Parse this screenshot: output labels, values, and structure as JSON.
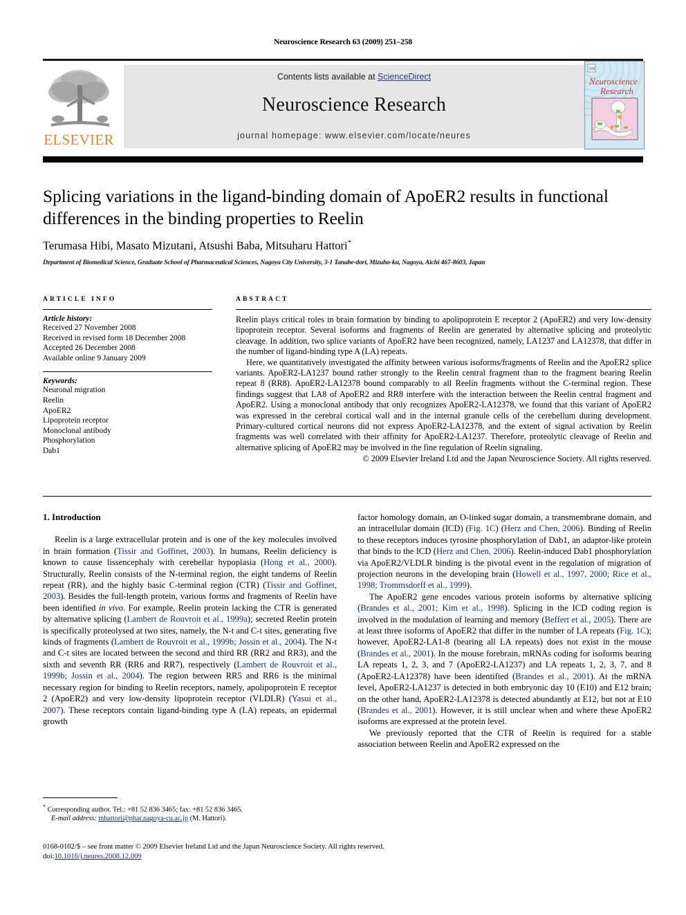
{
  "running_head": "Neuroscience Research 63 (2009) 251–258",
  "masthead": {
    "contents_prefix": "Contents lists available at ",
    "sciencedirect": "ScienceDirect",
    "journal_name": "Neuroscience Research",
    "homepage": "journal homepage: www.elsevier.com/locate/neures",
    "publisher_wordmark": "ELSEVIER",
    "cover_title_line1": "Neuroscience",
    "cover_title_line2": "Research",
    "accent_orange": "#F58220",
    "link_blue": "#2b3a8f",
    "reference_blue": "#1b2a73",
    "masthead_bg": "#e6e6e6"
  },
  "article": {
    "title": "Splicing variations in the ligand-binding domain of ApoER2 results in functional differences in the binding properties to Reelin",
    "authors": "Terumasa Hibi, Masato Mizutani, Atsushi Baba, Mitsuharu Hattori",
    "author_footnote_marker": "*",
    "affiliation": "Department of Biomedical Science, Graduate School of Pharmaceutical Sciences, Nagoya City University, 3-1 Tanabe-dori, Mizuho-ku, Nagoya, Aichi 467-8603, Japan"
  },
  "article_info": {
    "heading": "ARTICLE INFO",
    "history_label": "Article history:",
    "history": [
      "Received 27 November 2008",
      "Received in revised form 18 December 2008",
      "Accepted 26 December 2008",
      "Available online 9 January 2009"
    ],
    "keywords_label": "Keywords:",
    "keywords": [
      "Neuronal migration",
      "Reelin",
      "ApoER2",
      "Lipoprotein receptor",
      "Monoclonal antibody",
      "Phosphorylation",
      "Dab1"
    ]
  },
  "abstract": {
    "heading": "ABSTRACT",
    "paragraph1": "Reelin plays critical roles in brain formation by binding to apolipoprotein E receptor 2 (ApoER2) and very low-density lipoprotein receptor. Several isoforms and fragments of Reelin are generated by alternative splicing and proteolytic cleavage. In addition, two splice variants of ApoER2 have been recognized, namely, LA1237 and LA12378, that differ in the number of ligand-binding type A (LA) repeats.",
    "paragraph2": "Here, we quantitatively investigated the affinity between various isoforms/fragments of Reelin and the ApoER2 splice variants. ApoER2-LA1237 bound rather strongly to the Reelin central fragment than to the fragment bearing Reelin repeat 8 (RR8). ApoER2-LA12378 bound comparably to all Reelin fragments without the C-terminal region. These findings suggest that LA8 of ApoER2 and RR8 interfere with the interaction between the Reelin central fragment and ApoER2. Using a monoclonal antibody that only recognizes ApoER2-LA12378, we found that this variant of ApoER2 was expressed in the cerebral cortical wall and in the internal granule cells of the cerebellum during development. Primary-cultured cortical neurons did not express ApoER2-LA12378, and the extent of signal activation by Reelin fragments was well correlated with their affinity for ApoER2-LA1237. Therefore, proteolytic cleavage of Reelin and alternative splicing of ApoER2 may be involved in the fine regulation of Reelin signaling.",
    "copyright": "© 2009 Elsevier Ireland Ltd and the Japan Neuroscience Society. All rights reserved."
  },
  "body": {
    "section_title": "1. Introduction",
    "left_paragraphs": [
      "Reelin is a large extracellular protein and is one of the key molecules involved in brain formation (Tissir and Goffinet, 2003). In humans, Reelin deficiency is known to cause lissencephaly with cerebellar hypoplasia (Hong et al., 2000). Structurally, Reelin consists of the N-terminal region, the eight tandems of Reelin repeat (RR), and the highly basic C-terminal region (CTR) (Tissir and Goffinet, 2003). Besides the full-length protein, various forms and fragments of Reelin have been identified in vivo. For example, Reelin protein lacking the CTR is generated by alternative splicing (Lambert de Rouvroit et al., 1999a); secreted Reelin protein is specifically proteolysed at two sites, namely, the N-t and C-t sites, generating five kinds of fragments (Lambert de Rouvroit et al., 1999b; Jossin et al., 2004). The N-t and C-t sites are located between the second and third RR (RR2 and RR3), and the sixth and seventh RR (RR6 and RR7), respectively (Lambert de Rouvroit et al., 1999b; Jossin et al., 2004). The region between RR5 and RR6 is the minimal necessary region for binding to Reelin receptors, namely, apolipoprotein E receptor 2 (ApoER2) and very low-density lipoprotein receptor (VLDLR) (Yasui et al., 2007). These receptors contain ligand-binding type A (LA) repeats, an epidermal growth"
    ],
    "right_paragraphs": [
      "factor homology domain, an O-linked sugar domain, a transmembrane domain, and an intracellular domain (ICD) (Fig. 1C) (Herz and Chen, 2006). Binding of Reelin to these receptors induces tyrosine phosphorylation of Dab1, an adaptor-like protein that binds to the ICD (Herz and Chen, 2006). Reelin-induced Dab1 phosphorylation via ApoER2/VLDLR binding is the pivotal event in the regulation of migration of projection neurons in the developing brain (Howell et al., 1997, 2000; Rice et al., 1998; Trommsdorff et al., 1999).",
      "The ApoER2 gene encodes various protein isoforms by alternative splicing (Brandes et al., 2001; Kim et al., 1998). Splicing in the ICD coding region is involved in the modulation of learning and memory (Beffert et al., 2005). There are at least three isoforms of ApoER2 that differ in the number of LA repeats (Fig. 1C); however, ApoER2-LA1-8 (bearing all LA repeats) does not exist in the mouse (Brandes et al., 2001). In the mouse forebrain, mRNAs coding for isoforms bearing LA repeats 1, 2, 3, and 7 (ApoER2-LA1237) and LA repeats 1, 2, 3, 7, and 8 (ApoER2-LA12378) have been identified (Brandes et al., 2001). At the mRNA level, ApoER2-LA1237 is detected in both embryonic day 10 (E10) and E12 brain; on the other hand, ApoER2-LA12378 is detected abundantly at E12, but not at E10 (Brandes et al., 2001). However, it is still unclear when and where these ApoER2 isoforms are expressed at the protein level.",
      "We previously reported that the CTR of Reelin is required for a stable association between Reelin and ApoER2 expressed on the"
    ]
  },
  "footnote": {
    "marker": "*",
    "line1": "Corresponding author. Tel.: +81 52 836 3465; fax: +81 52 836 3465.",
    "email_label": "E-mail address:",
    "email": "mhattori@phar.nagoya-cu.ac.jp",
    "email_owner": "(M. Hattori)."
  },
  "bottom_matter": {
    "issn_line": "0168-0102/$ – see front matter © 2009 Elsevier Ireland Ltd and the Japan Neuroscience Society. All rights reserved.",
    "doi_label": "doi:",
    "doi": "10.1016/j.neures.2008.12.009"
  }
}
